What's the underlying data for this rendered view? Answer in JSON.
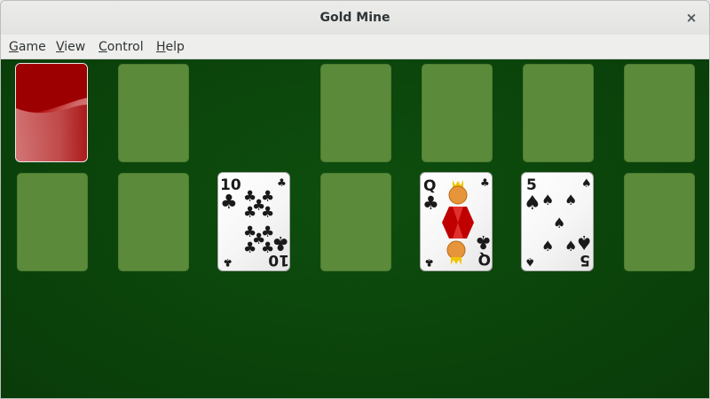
{
  "window": {
    "title": "Gold Mine",
    "close_glyph": "×"
  },
  "menu": [
    {
      "label_mnemonic": "G",
      "label_rest": "ame"
    },
    {
      "label_mnemonic": "V",
      "label_rest": "iew"
    },
    {
      "label_mnemonic": "C",
      "label_rest": "ontrol"
    },
    {
      "label_mnemonic": "H",
      "label_rest": "elp"
    }
  ],
  "board": {
    "felt_color": "#0b430b",
    "slot_color": "#5a8a3a",
    "stock": {
      "face": "down",
      "back_color": "#b10000"
    },
    "cards": [
      {
        "rank": "10",
        "suit": "clubs",
        "suit_glyph": "♣"
      },
      {
        "rank": "Q",
        "suit": "clubs",
        "suit_glyph": "♣"
      },
      {
        "rank": "5",
        "suit": "spades",
        "suit_glyph": "♠"
      }
    ]
  }
}
